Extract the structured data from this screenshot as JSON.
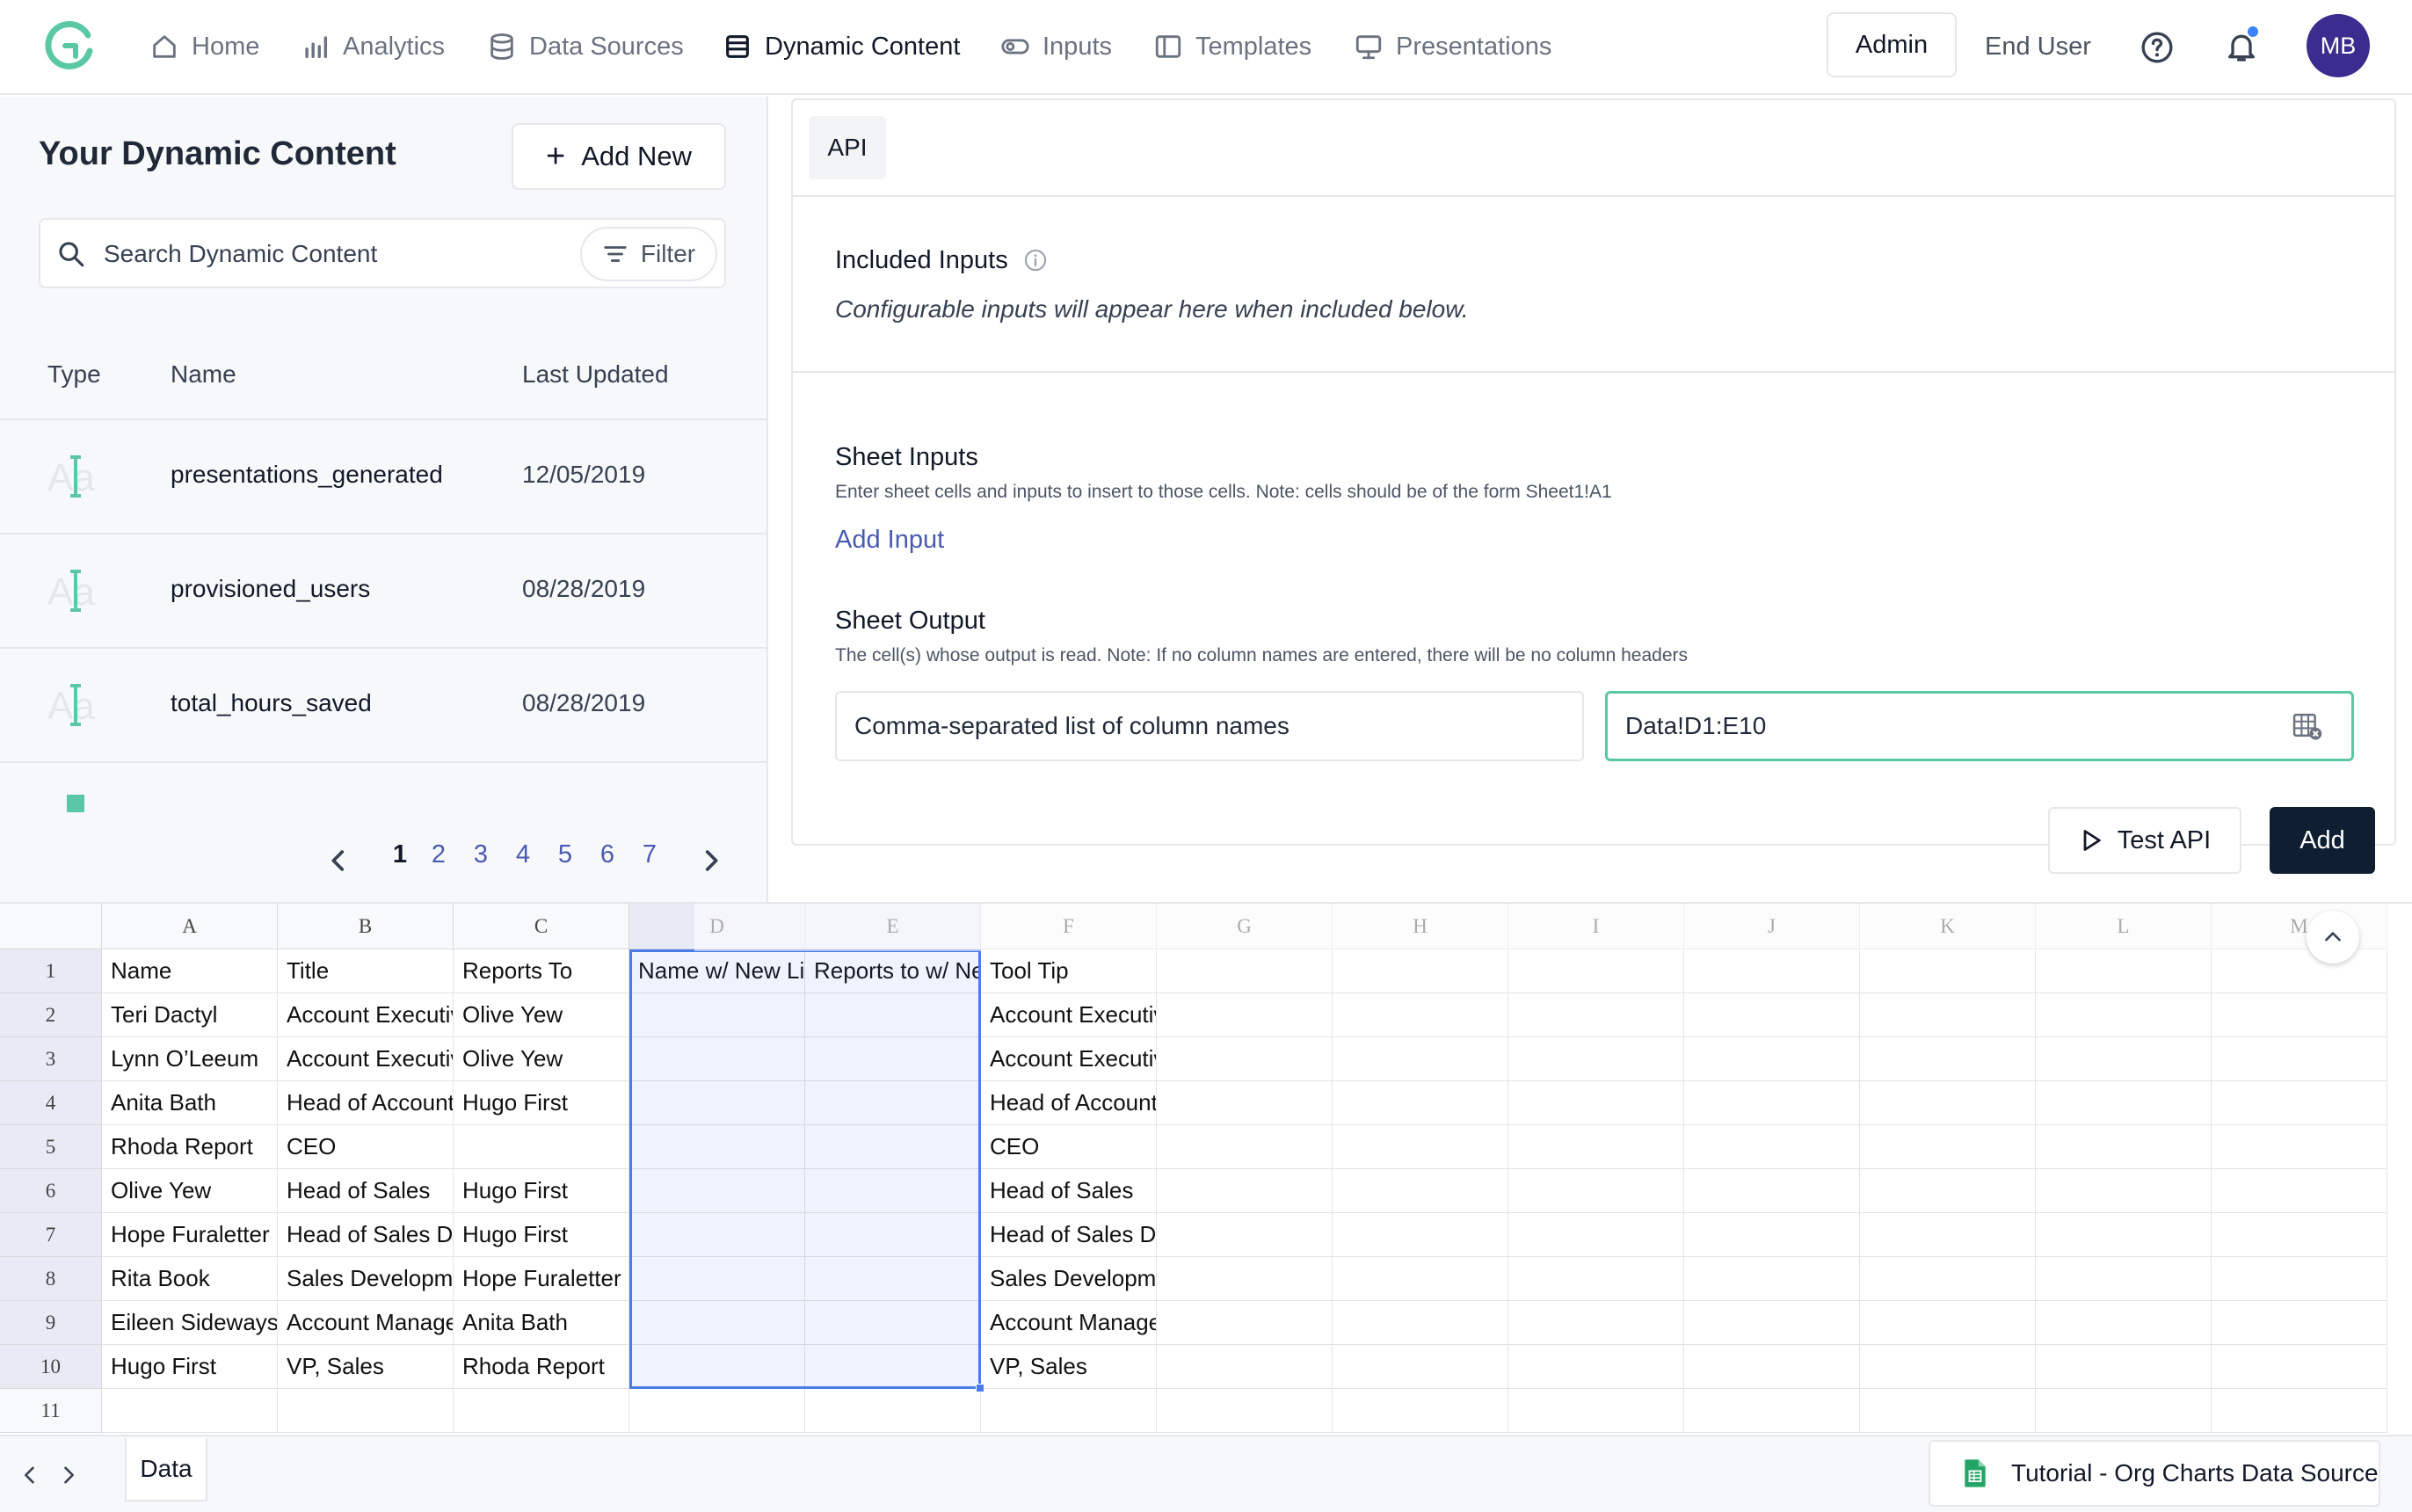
{
  "nav": {
    "items": [
      {
        "label": "Home",
        "icon": "home-icon"
      },
      {
        "label": "Analytics",
        "icon": "bar-chart-icon"
      },
      {
        "label": "Data Sources",
        "icon": "database-icon"
      },
      {
        "label": "Dynamic Content",
        "icon": "stack-icon",
        "active": true
      },
      {
        "label": "Inputs",
        "icon": "toggle-icon"
      },
      {
        "label": "Templates",
        "icon": "layout-icon"
      },
      {
        "label": "Presentations",
        "icon": "presentation-icon"
      }
    ],
    "admin_label": "Admin",
    "end_user_label": "End User",
    "avatar_initials": "MB",
    "accent_color": "#5ac8a4",
    "avatar_color": "#3b2d8f"
  },
  "left": {
    "title": "Your Dynamic Content",
    "add_new_label": "Add New",
    "search_placeholder": "Search Dynamic Content",
    "filter_label": "Filter",
    "columns": [
      "Type",
      "Name",
      "Last Updated"
    ],
    "rows": [
      {
        "type": "text-icon",
        "name": "presentations_generated",
        "date": "12/05/2019"
      },
      {
        "type": "text-icon",
        "name": "provisioned_users",
        "date": "08/28/2019"
      },
      {
        "type": "text-icon",
        "name": "total_hours_saved",
        "date": "08/28/2019"
      }
    ],
    "pagination": {
      "current": "1",
      "pages": [
        "1",
        "2",
        "3",
        "4",
        "5",
        "6",
        "7"
      ]
    }
  },
  "api": {
    "tab_label": "API",
    "included_inputs_title": "Included Inputs",
    "included_inputs_note": "Configurable inputs will appear here when included below.",
    "sheet_inputs_title": "Sheet Inputs",
    "sheet_inputs_desc": "Enter sheet cells and inputs to insert to those cells. Note: cells should be of the form Sheet1!A1",
    "add_input_label": "Add Input",
    "sheet_output_title": "Sheet Output",
    "sheet_output_desc": "The cell(s) whose output is read. Note: If no column names are entered, there will be no column headers",
    "column_names_placeholder": "Comma-separated list of column names",
    "range_value": "Data!D1:E10",
    "test_api_label": "Test API",
    "add_label": "Add"
  },
  "sheet": {
    "columns": [
      "A",
      "B",
      "C",
      "D",
      "E",
      "F",
      "G",
      "H",
      "I",
      "J",
      "K",
      "L",
      "M"
    ],
    "row_numbers": [
      "1",
      "2",
      "3",
      "4",
      "5",
      "6",
      "7",
      "8",
      "9",
      "10",
      "11"
    ],
    "rows": [
      [
        "Name",
        "Title",
        "Reports To",
        "Name w/ New Line",
        "Reports to w/ New Line",
        "Tool Tip"
      ],
      [
        "Teri Dactyl",
        "Account Executive",
        "Olive Yew",
        "",
        "",
        "Account Executive"
      ],
      [
        "Lynn O’Leeum",
        "Account Executive",
        "Olive Yew",
        "",
        "",
        "Account Executive"
      ],
      [
        "Anita Bath",
        "Head of Account",
        "Hugo First",
        "",
        "",
        "Head of Account"
      ],
      [
        "Rhoda Report",
        "CEO",
        "",
        "",
        "",
        "CEO"
      ],
      [
        "Olive Yew",
        "Head of Sales",
        "Hugo First",
        "",
        "",
        "Head of Sales"
      ],
      [
        "Hope Furaletter",
        "Head of Sales D",
        "Hugo First",
        "",
        "",
        "Head of Sales D"
      ],
      [
        "Rita Book",
        "Sales Development",
        "Hope Furaletter",
        "",
        "",
        "Sales Development"
      ],
      [
        "Eileen Sideways",
        "Account Manager",
        "Anita Bath",
        "",
        "",
        "Account Manager"
      ],
      [
        "Hugo First",
        "VP, Sales",
        "Rhoda Report",
        "",
        "",
        "VP, Sales"
      ]
    ],
    "tab_label": "Data",
    "source_name": "Tutorial - Org Charts Data Source",
    "selection_color": "#4a7de8"
  }
}
